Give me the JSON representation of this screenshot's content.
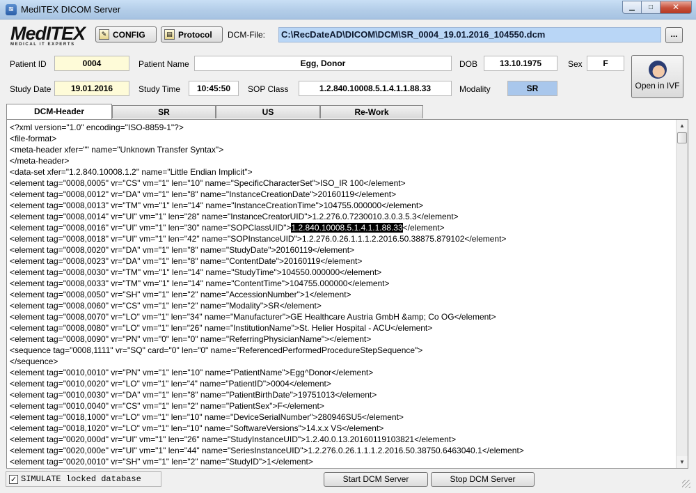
{
  "window": {
    "title": "MedITEX DICOM Server",
    "minimize_glyph": "▁",
    "maximize_glyph": "□",
    "close_glyph": "✕"
  },
  "toolbar": {
    "logo_text": "MedITEX",
    "logo_subtext": "MEDICAL IT EXPERTS",
    "config_label": "CONFIG",
    "protocol_label": "Protocol",
    "dcm_file_label": "DCM-File:",
    "dcm_file_value": "C:\\RecDateAD\\DICOM\\DCM\\SR_0004_19.01.2016_104550.dcm",
    "browse_label": "..."
  },
  "patient": {
    "id_label": "Patient ID",
    "id_value": "0004",
    "name_label": "Patient Name",
    "name_value": "Egg, Donor",
    "dob_label": "DOB",
    "dob_value": "13.10.1975",
    "sex_label": "Sex",
    "sex_value": "F",
    "study_date_label": "Study Date",
    "study_date_value": "19.01.2016",
    "study_time_label": "Study Time",
    "study_time_value": "10:45:50",
    "sop_class_label": "SOP Class",
    "sop_class_value": "1.2.840.10008.5.1.4.1.1.88.33",
    "modality_label": "Modality",
    "modality_value": "SR",
    "open_ivf_label": "Open in IVF"
  },
  "tabs": [
    {
      "label": "DCM-Header",
      "active": true
    },
    {
      "label": "SR"
    },
    {
      "label": "US"
    },
    {
      "label": "Re-Work"
    }
  ],
  "header_lines": [
    "<?xml version=\"1.0\" encoding=\"ISO-8859-1\"?>",
    "<file-format>",
    "<meta-header xfer=\"\" name=\"Unknown Transfer Syntax\">",
    "</meta-header>",
    "<data-set xfer=\"1.2.840.10008.1.2\" name=\"Little Endian Implicit\">",
    "<element tag=\"0008,0005\" vr=\"CS\" vm=\"1\" len=\"10\" name=\"SpecificCharacterSet\">ISO_IR 100</element>",
    "<element tag=\"0008,0012\" vr=\"DA\" vm=\"1\" len=\"8\" name=\"InstanceCreationDate\">20160119</element>",
    "<element tag=\"0008,0013\" vr=\"TM\" vm=\"1\" len=\"14\" name=\"InstanceCreationTime\">104755.000000</element>",
    "<element tag=\"0008,0014\" vr=\"UI\" vm=\"1\" len=\"28\" name=\"InstanceCreatorUID\">1.2.276.0.7230010.3.0.3.5.3</element>",
    "<element tag=\"0008,0016\" vr=\"UI\" vm=\"1\" len=\"30\" name=\"SOPClassUID\">",
    "<element tag=\"0008,0018\" vr=\"UI\" vm=\"1\" len=\"42\" name=\"SOPInstanceUID\">1.2.276.0.26.1.1.1.2.2016.50.38875.879102</element>",
    "<element tag=\"0008,0020\" vr=\"DA\" vm=\"1\" len=\"8\" name=\"StudyDate\">20160119</element>",
    "<element tag=\"0008,0023\" vr=\"DA\" vm=\"1\" len=\"8\" name=\"ContentDate\">20160119</element>",
    "<element tag=\"0008,0030\" vr=\"TM\" vm=\"1\" len=\"14\" name=\"StudyTime\">104550.000000</element>",
    "<element tag=\"0008,0033\" vr=\"TM\" vm=\"1\" len=\"14\" name=\"ContentTime\">104755.000000</element>",
    "<element tag=\"0008,0050\" vr=\"SH\" vm=\"1\" len=\"2\" name=\"AccessionNumber\">1</element>",
    "<element tag=\"0008,0060\" vr=\"CS\" vm=\"1\" len=\"2\" name=\"Modality\">SR</element>",
    "<element tag=\"0008,0070\" vr=\"LO\" vm=\"1\" len=\"34\" name=\"Manufacturer\">GE Healthcare Austria GmbH &amp; Co OG</element>",
    "<element tag=\"0008,0080\" vr=\"LO\" vm=\"1\" len=\"26\" name=\"InstitutionName\">St. Helier Hospital - ACU</element>",
    "<element tag=\"0008,0090\" vr=\"PN\" vm=\"0\" len=\"0\" name=\"ReferringPhysicianName\"></element>",
    "<sequence tag=\"0008,1111\" vr=\"SQ\" card=\"0\" len=\"0\" name=\"ReferencedPerformedProcedureStepSequence\">",
    "</sequence>",
    "<element tag=\"0010,0010\" vr=\"PN\" vm=\"1\" len=\"10\" name=\"PatientName\">Egg^Donor</element>",
    "<element tag=\"0010,0020\" vr=\"LO\" vm=\"1\" len=\"4\" name=\"PatientID\">0004</element>",
    "<element tag=\"0010,0030\" vr=\"DA\" vm=\"1\" len=\"8\" name=\"PatientBirthDate\">19751013</element>",
    "<element tag=\"0010,0040\" vr=\"CS\" vm=\"1\" len=\"2\" name=\"PatientSex\">F</element>",
    "<element tag=\"0018,1000\" vr=\"LO\" vm=\"1\" len=\"10\" name=\"DeviceSerialNumber\">280946SU5</element>",
    "<element tag=\"0018,1020\" vr=\"LO\" vm=\"1\" len=\"10\" name=\"SoftwareVersions\">14.x.x VS</element>",
    "<element tag=\"0020,000d\" vr=\"UI\" vm=\"1\" len=\"26\" name=\"StudyInstanceUID\">1.2.40.0.13.20160119103821</element>",
    "<element tag=\"0020,000e\" vr=\"UI\" vm=\"1\" len=\"44\" name=\"SeriesInstanceUID\">1.2.276.0.26.1.1.1.2.2016.50.38750.6463040.1</element>",
    "<element tag=\"0020,0010\" vr=\"SH\" vm=\"1\" len=\"2\" name=\"StudyID\">1</element>"
  ],
  "selection": {
    "line_index": 9,
    "selected_text": "1.2.840.10008.5.1.4.1.1.88.33",
    "after_text": "</element>"
  },
  "status": {
    "simulate_label": "SIMULATE locked database",
    "simulate_checked": true,
    "start_label": "Start DCM Server",
    "stop_label": "Stop DCM Server"
  },
  "scroll": {
    "up_glyph": "▲",
    "down_glyph": "▼"
  }
}
